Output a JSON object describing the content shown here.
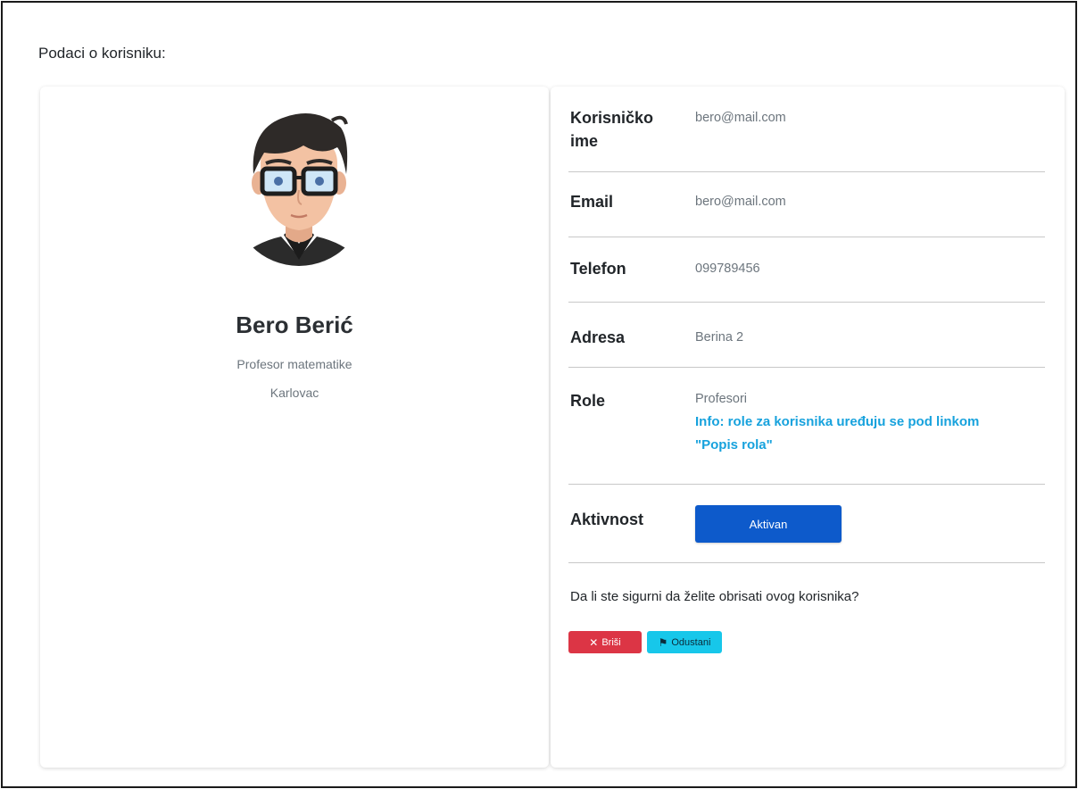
{
  "header": {
    "title": "Podaci o korisniku:"
  },
  "profile": {
    "name": "Bero Berić",
    "title": "Profesor matematike",
    "city": "Karlovac"
  },
  "details": {
    "username_label": "Korisničko ime",
    "username_value": "bero@mail.com",
    "email_label": "Email",
    "email_value": "bero@mail.com",
    "phone_label": "Telefon",
    "phone_value": "099789456",
    "address_label": "Adresa",
    "address_value": "Berina 2",
    "role_label": "Role",
    "role_value": "Profesori",
    "role_info": "Info: role za korisnika uređuju se pod linkom \"Popis rola\"",
    "activity_label": "Aktivnost",
    "activity_button": "Aktivan"
  },
  "confirm": {
    "question": "Da li ste sigurni da želite obrisati ovog korisnika?",
    "delete_label": "Briši",
    "cancel_label": "Odustani"
  },
  "colors": {
    "primary": "#0d5acb",
    "danger": "#dc3545",
    "info": "#17c7ea",
    "info_text": "#17a2dd"
  },
  "icons": {
    "delete": "x-icon",
    "cancel": "flag-icon",
    "avatar": "user-avatar"
  }
}
